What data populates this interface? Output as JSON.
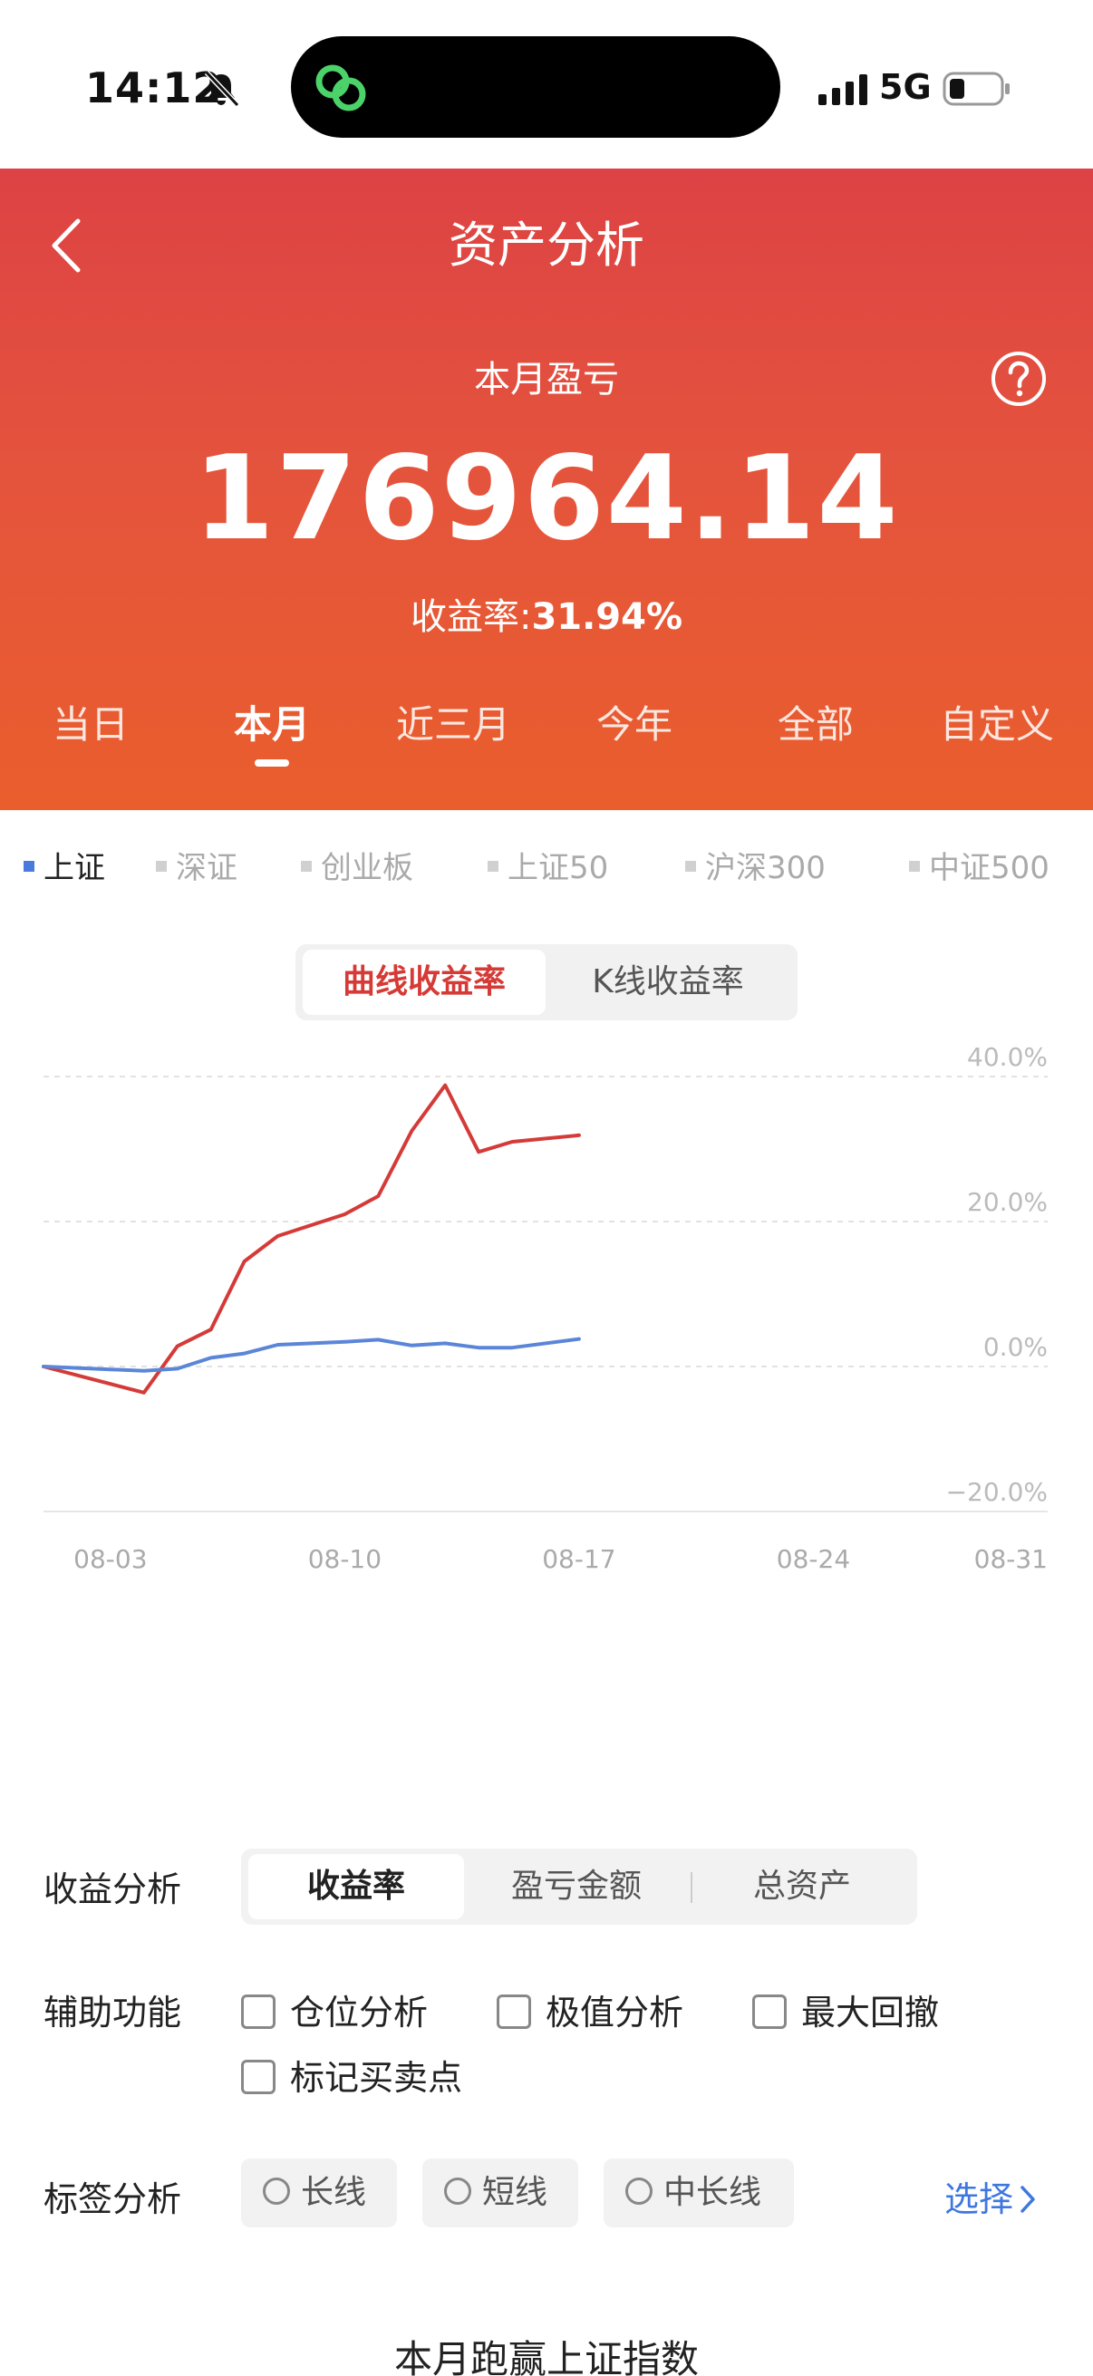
{
  "status_bar": {
    "time": "14:12",
    "network": "5G"
  },
  "header": {
    "title": "资产分析",
    "period_label": "本月盈亏",
    "profit_value": "176964.14",
    "yield_label": "收益率:",
    "yield_value": "31.94%",
    "tabs": [
      {
        "label": "当日"
      },
      {
        "label": "本月",
        "active": true
      },
      {
        "label": "近三月"
      },
      {
        "label": "今年"
      },
      {
        "label": "全部"
      },
      {
        "label": "自定义"
      }
    ]
  },
  "index_selector": {
    "items": [
      {
        "label": "上证",
        "active": true
      },
      {
        "label": "深证"
      },
      {
        "label": "创业板"
      },
      {
        "label": "上证50"
      },
      {
        "label": "沪深300"
      },
      {
        "label": "中证500"
      }
    ]
  },
  "chart_toggle": {
    "active": "曲线收益率",
    "inactive": "K线收益率"
  },
  "chart_data": {
    "type": "line",
    "y_ticks": [
      "40.0%",
      "20.0%",
      "0.0%",
      "−20.0%"
    ],
    "x_ticks": [
      "08-03",
      "08-10",
      "08-17",
      "08-24",
      "08-31"
    ],
    "ylim": [
      -20,
      40
    ],
    "x_days": [
      1,
      31
    ],
    "series": [
      {
        "color": "#d43b38",
        "points": [
          [
            1,
            0.0
          ],
          [
            4,
            -3.6
          ],
          [
            5,
            2.8
          ],
          [
            6,
            5.1
          ],
          [
            7,
            14.5
          ],
          [
            8,
            18.0
          ],
          [
            10,
            21.0
          ],
          [
            11,
            23.5
          ],
          [
            12,
            32.5
          ],
          [
            13,
            38.8
          ],
          [
            14,
            29.6
          ],
          [
            15,
            31.0
          ],
          [
            17,
            31.9
          ]
        ]
      },
      {
        "color": "#5b86d8",
        "points": [
          [
            1,
            0.0
          ],
          [
            4,
            -0.6
          ],
          [
            5,
            -0.3
          ],
          [
            6,
            1.2
          ],
          [
            7,
            1.8
          ],
          [
            8,
            3.0
          ],
          [
            10,
            3.4
          ],
          [
            11,
            3.7
          ],
          [
            12,
            2.9
          ],
          [
            13,
            3.2
          ],
          [
            14,
            2.6
          ],
          [
            15,
            2.6
          ],
          [
            17,
            3.8
          ]
        ]
      }
    ]
  },
  "analysis": {
    "profit_label": "收益分析",
    "profit_tabs": [
      {
        "label": "收益率",
        "active": true
      },
      {
        "label": "盈亏金额"
      },
      {
        "label": "总资产"
      }
    ],
    "aux_label": "辅助功能",
    "aux_options": [
      "仓位分析",
      "极值分析",
      "最大回撤",
      "标记买卖点"
    ],
    "tag_label": "标签分析",
    "tag_options": [
      "长线",
      "短线",
      "中长线"
    ],
    "tag_choose": "选择"
  },
  "footer_title": "本月跑赢上证指数",
  "colors": {
    "accent_red": "#d63a36",
    "link_blue": "#3e77e0",
    "index_blue": "#4a7bdc"
  }
}
